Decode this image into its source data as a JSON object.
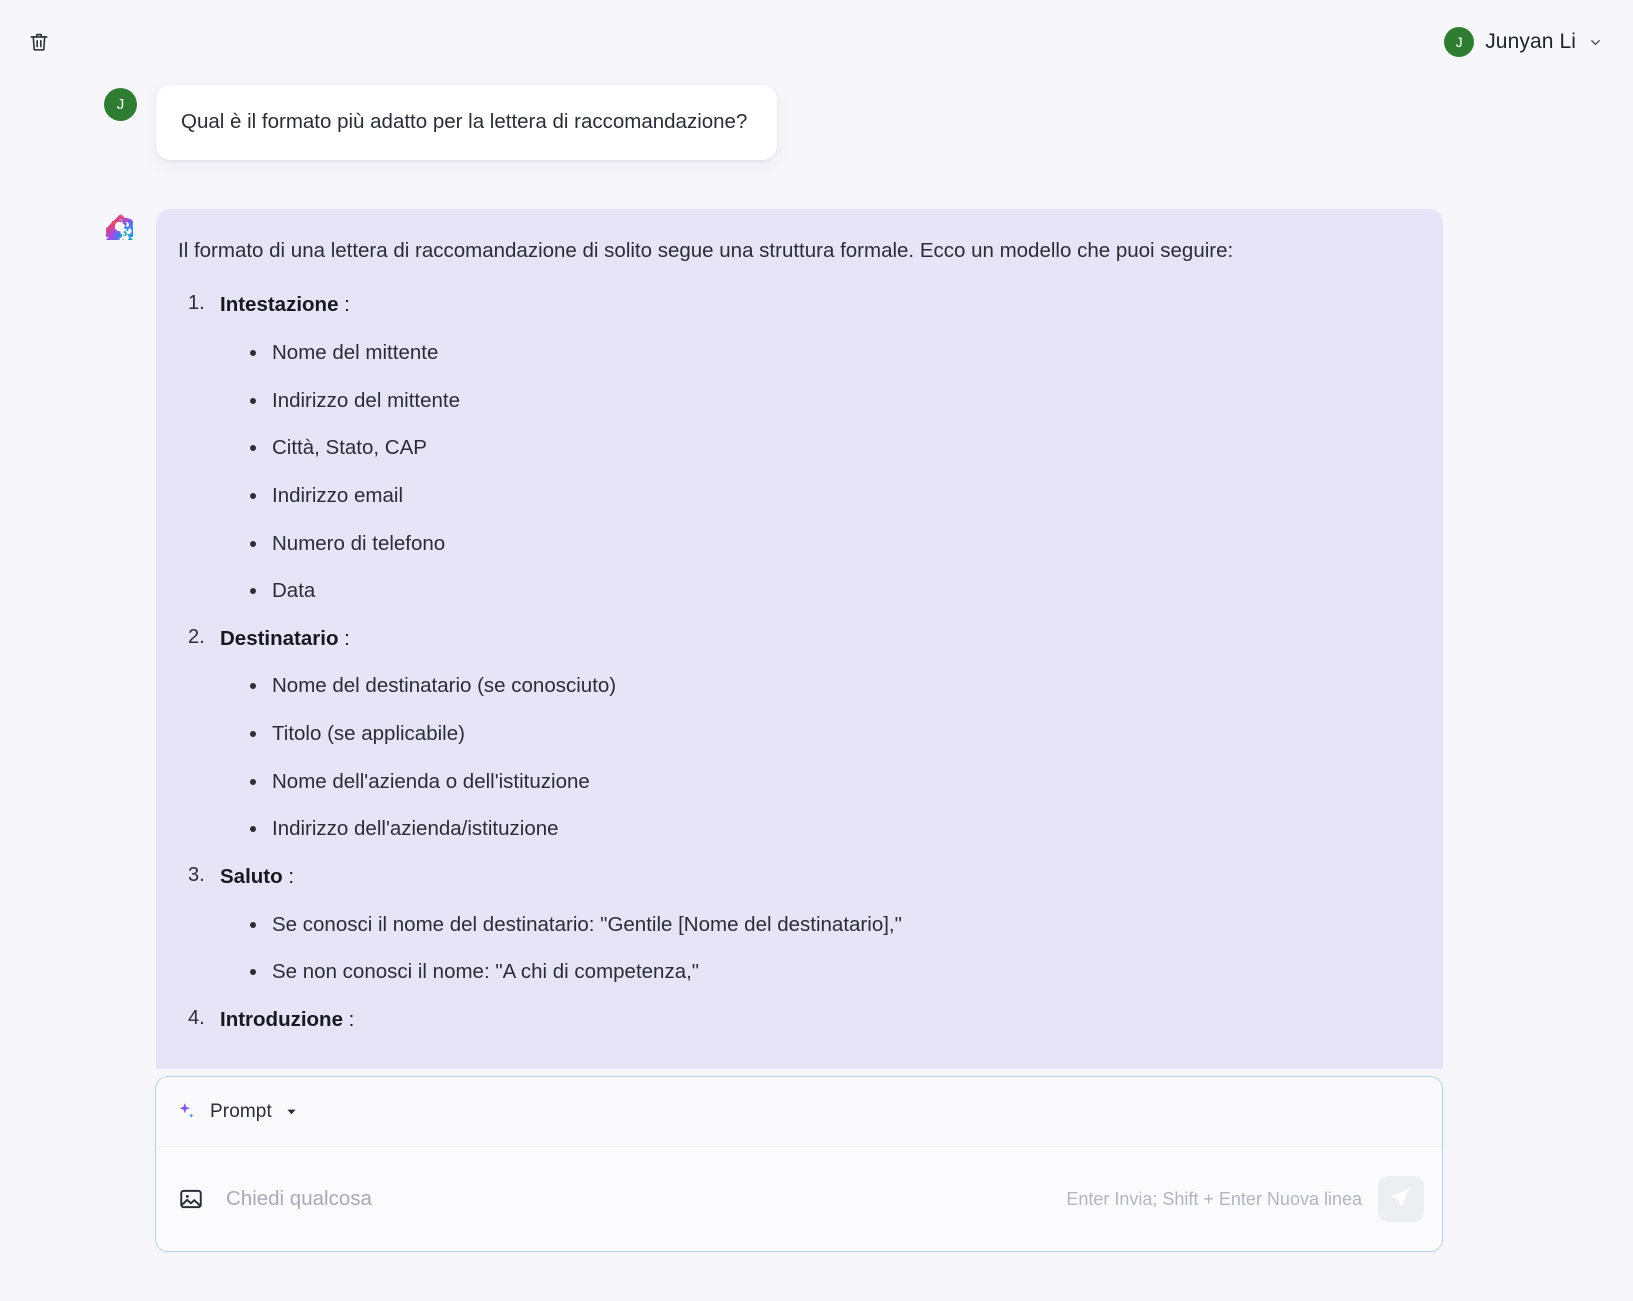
{
  "topbar": {
    "delete_icon": "trash-icon",
    "user": {
      "avatar_initial": "J",
      "name": "Junyan Li",
      "chevron_icon": "chevron-down-icon",
      "avatar_color": "#2f7d32"
    }
  },
  "conversation": {
    "user_message": {
      "avatar_initial": "J",
      "text": "Qual è il formato più adatto per la lettera di raccomandazione?"
    },
    "assistant_message": {
      "avatar_icon": "sparkle-flower-icon",
      "intro": "Il formato di una lettera di raccomandazione di solito segue una struttura formale. Ecco un modello che puoi seguire:",
      "sections": [
        {
          "title": "Intestazione",
          "colon": " :",
          "items": [
            "Nome del mittente",
            "Indirizzo del mittente",
            "Città, Stato, CAP",
            "Indirizzo email",
            "Numero di telefono",
            "Data"
          ]
        },
        {
          "title": "Destinatario",
          "colon": " :",
          "items": [
            "Nome del destinatario (se conosciuto)",
            "Titolo (se applicabile)",
            "Nome dell'azienda o dell'istituzione",
            "Indirizzo dell'azienda/istituzione"
          ]
        },
        {
          "title": "Saluto",
          "colon": " :",
          "items": [
            "Se conosci il nome del destinatario: \"Gentile [Nome del destinatario],\"",
            "Se non conosci il nome: \"A chi di competenza,\""
          ]
        },
        {
          "title": "Introduzione",
          "colon": " :",
          "items": []
        }
      ]
    }
  },
  "composer": {
    "mode_icon": "sparkle-icon",
    "mode_label": "Prompt",
    "mode_caret_icon": "caret-down-icon",
    "attach_image_icon": "image-icon",
    "input_value": "",
    "input_placeholder": "Chiedi qualcosa",
    "hint": "Enter Invia; Shift + Enter Nuova linea",
    "send_icon": "send-icon"
  },
  "colors": {
    "page_bg": "#f7f7fb",
    "assistant_bubble": "#e7e4f7",
    "user_bubble": "#ffffff",
    "composer_border": "#b9d3ef",
    "avatar_green": "#2f7d32"
  }
}
